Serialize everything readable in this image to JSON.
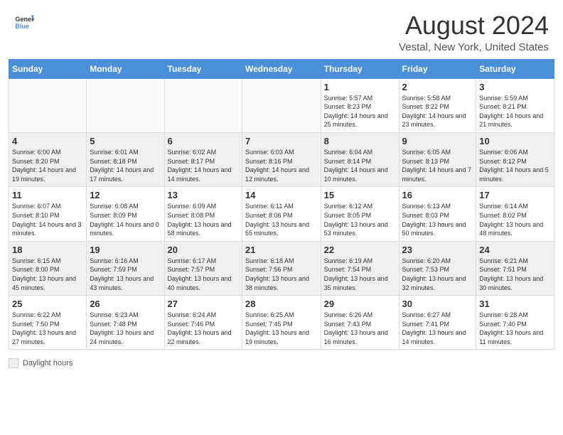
{
  "logo": {
    "general": "General",
    "blue": "Blue"
  },
  "title": {
    "month_year": "August 2024",
    "location": "Vestal, New York, United States"
  },
  "days_of_week": [
    "Sunday",
    "Monday",
    "Tuesday",
    "Wednesday",
    "Thursday",
    "Friday",
    "Saturday"
  ],
  "weeks": [
    [
      {
        "day": "",
        "sunrise": "",
        "sunset": "",
        "daylight": ""
      },
      {
        "day": "",
        "sunrise": "",
        "sunset": "",
        "daylight": ""
      },
      {
        "day": "",
        "sunrise": "",
        "sunset": "",
        "daylight": ""
      },
      {
        "day": "",
        "sunrise": "",
        "sunset": "",
        "daylight": ""
      },
      {
        "day": "1",
        "sunrise": "Sunrise: 5:57 AM",
        "sunset": "Sunset: 8:23 PM",
        "daylight": "Daylight: 14 hours and 25 minutes."
      },
      {
        "day": "2",
        "sunrise": "Sunrise: 5:58 AM",
        "sunset": "Sunset: 8:22 PM",
        "daylight": "Daylight: 14 hours and 23 minutes."
      },
      {
        "day": "3",
        "sunrise": "Sunrise: 5:59 AM",
        "sunset": "Sunset: 8:21 PM",
        "daylight": "Daylight: 14 hours and 21 minutes."
      }
    ],
    [
      {
        "day": "4",
        "sunrise": "Sunrise: 6:00 AM",
        "sunset": "Sunset: 8:20 PM",
        "daylight": "Daylight: 14 hours and 19 minutes."
      },
      {
        "day": "5",
        "sunrise": "Sunrise: 6:01 AM",
        "sunset": "Sunset: 8:18 PM",
        "daylight": "Daylight: 14 hours and 17 minutes."
      },
      {
        "day": "6",
        "sunrise": "Sunrise: 6:02 AM",
        "sunset": "Sunset: 8:17 PM",
        "daylight": "Daylight: 14 hours and 14 minutes."
      },
      {
        "day": "7",
        "sunrise": "Sunrise: 6:03 AM",
        "sunset": "Sunset: 8:16 PM",
        "daylight": "Daylight: 14 hours and 12 minutes."
      },
      {
        "day": "8",
        "sunrise": "Sunrise: 6:04 AM",
        "sunset": "Sunset: 8:14 PM",
        "daylight": "Daylight: 14 hours and 10 minutes."
      },
      {
        "day": "9",
        "sunrise": "Sunrise: 6:05 AM",
        "sunset": "Sunset: 8:13 PM",
        "daylight": "Daylight: 14 hours and 7 minutes."
      },
      {
        "day": "10",
        "sunrise": "Sunrise: 6:06 AM",
        "sunset": "Sunset: 8:12 PM",
        "daylight": "Daylight: 14 hours and 5 minutes."
      }
    ],
    [
      {
        "day": "11",
        "sunrise": "Sunrise: 6:07 AM",
        "sunset": "Sunset: 8:10 PM",
        "daylight": "Daylight: 14 hours and 3 minutes."
      },
      {
        "day": "12",
        "sunrise": "Sunrise: 6:08 AM",
        "sunset": "Sunset: 8:09 PM",
        "daylight": "Daylight: 14 hours and 0 minutes."
      },
      {
        "day": "13",
        "sunrise": "Sunrise: 6:09 AM",
        "sunset": "Sunset: 8:08 PM",
        "daylight": "Daylight: 13 hours and 58 minutes."
      },
      {
        "day": "14",
        "sunrise": "Sunrise: 6:11 AM",
        "sunset": "Sunset: 8:06 PM",
        "daylight": "Daylight: 13 hours and 55 minutes."
      },
      {
        "day": "15",
        "sunrise": "Sunrise: 6:12 AM",
        "sunset": "Sunset: 8:05 PM",
        "daylight": "Daylight: 13 hours and 53 minutes."
      },
      {
        "day": "16",
        "sunrise": "Sunrise: 6:13 AM",
        "sunset": "Sunset: 8:03 PM",
        "daylight": "Daylight: 13 hours and 50 minutes."
      },
      {
        "day": "17",
        "sunrise": "Sunrise: 6:14 AM",
        "sunset": "Sunset: 8:02 PM",
        "daylight": "Daylight: 13 hours and 48 minutes."
      }
    ],
    [
      {
        "day": "18",
        "sunrise": "Sunrise: 6:15 AM",
        "sunset": "Sunset: 8:00 PM",
        "daylight": "Daylight: 13 hours and 45 minutes."
      },
      {
        "day": "19",
        "sunrise": "Sunrise: 6:16 AM",
        "sunset": "Sunset: 7:59 PM",
        "daylight": "Daylight: 13 hours and 43 minutes."
      },
      {
        "day": "20",
        "sunrise": "Sunrise: 6:17 AM",
        "sunset": "Sunset: 7:57 PM",
        "daylight": "Daylight: 13 hours and 40 minutes."
      },
      {
        "day": "21",
        "sunrise": "Sunrise: 6:18 AM",
        "sunset": "Sunset: 7:56 PM",
        "daylight": "Daylight: 13 hours and 38 minutes."
      },
      {
        "day": "22",
        "sunrise": "Sunrise: 6:19 AM",
        "sunset": "Sunset: 7:54 PM",
        "daylight": "Daylight: 13 hours and 35 minutes."
      },
      {
        "day": "23",
        "sunrise": "Sunrise: 6:20 AM",
        "sunset": "Sunset: 7:53 PM",
        "daylight": "Daylight: 13 hours and 32 minutes."
      },
      {
        "day": "24",
        "sunrise": "Sunrise: 6:21 AM",
        "sunset": "Sunset: 7:51 PM",
        "daylight": "Daylight: 13 hours and 30 minutes."
      }
    ],
    [
      {
        "day": "25",
        "sunrise": "Sunrise: 6:22 AM",
        "sunset": "Sunset: 7:50 PM",
        "daylight": "Daylight: 13 hours and 27 minutes."
      },
      {
        "day": "26",
        "sunrise": "Sunrise: 6:23 AM",
        "sunset": "Sunset: 7:48 PM",
        "daylight": "Daylight: 13 hours and 24 minutes."
      },
      {
        "day": "27",
        "sunrise": "Sunrise: 6:24 AM",
        "sunset": "Sunset: 7:46 PM",
        "daylight": "Daylight: 13 hours and 22 minutes."
      },
      {
        "day": "28",
        "sunrise": "Sunrise: 6:25 AM",
        "sunset": "Sunset: 7:45 PM",
        "daylight": "Daylight: 13 hours and 19 minutes."
      },
      {
        "day": "29",
        "sunrise": "Sunrise: 6:26 AM",
        "sunset": "Sunset: 7:43 PM",
        "daylight": "Daylight: 13 hours and 16 minutes."
      },
      {
        "day": "30",
        "sunrise": "Sunrise: 6:27 AM",
        "sunset": "Sunset: 7:41 PM",
        "daylight": "Daylight: 13 hours and 14 minutes."
      },
      {
        "day": "31",
        "sunrise": "Sunrise: 6:28 AM",
        "sunset": "Sunset: 7:40 PM",
        "daylight": "Daylight: 13 hours and 11 minutes."
      }
    ]
  ],
  "footer": {
    "daylight_hours_label": "Daylight hours"
  }
}
